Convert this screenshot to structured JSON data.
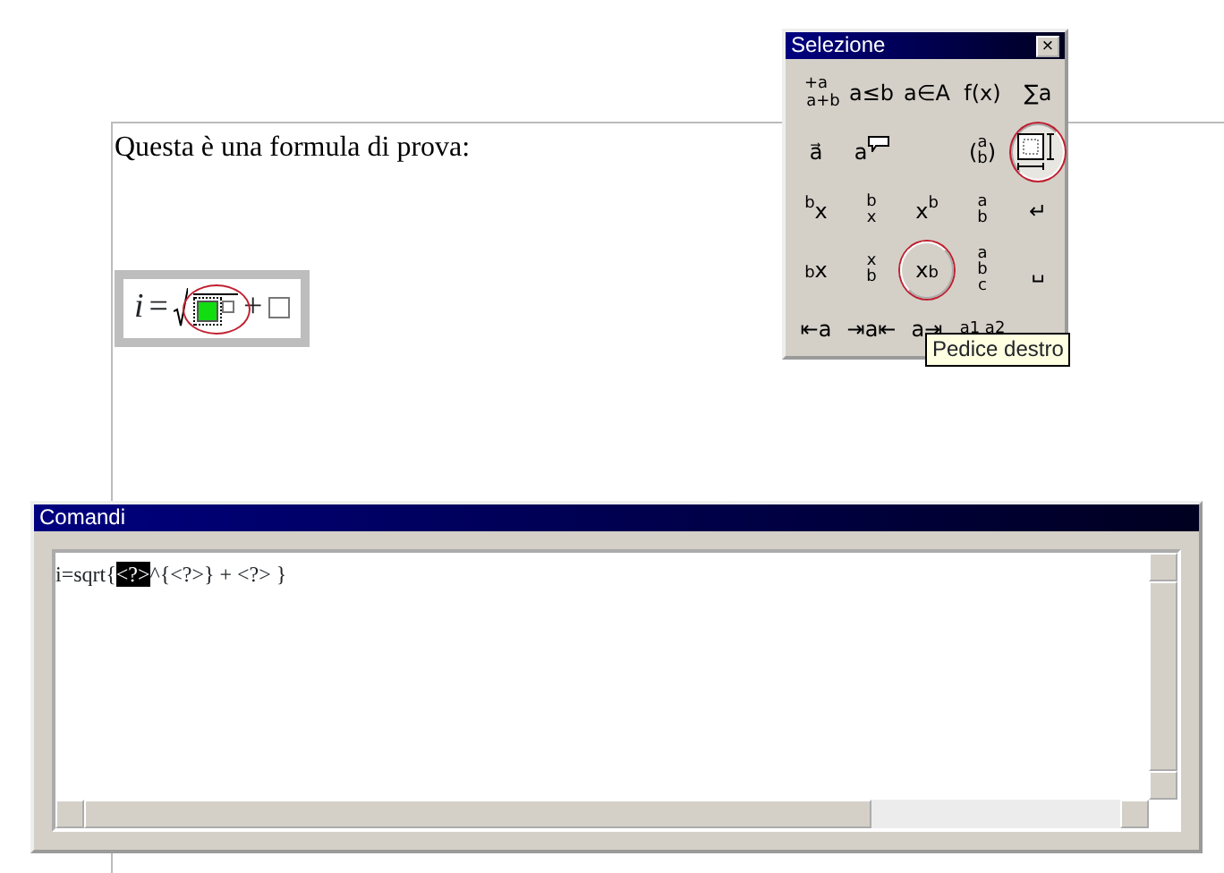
{
  "document": {
    "text": "Questa è una formula di prova:",
    "formula": {
      "lhs": "i",
      "equals": "=",
      "plus": "+",
      "highlighted": true,
      "placeholders": [
        {
          "selected": true
        },
        {
          "selected": false
        },
        {
          "selected": false
        }
      ]
    }
  },
  "palette": {
    "title": "Selezione",
    "close": "×",
    "buttons": [
      {
        "kind": "frac",
        "top": "+a",
        "bottom": "a+b",
        "pressed": false,
        "hovered": false,
        "highlighted": false
      },
      {
        "kind": "text",
        "label": "a≤b",
        "pressed": false,
        "hovered": false,
        "highlighted": false
      },
      {
        "kind": "text",
        "label": "a∈A",
        "pressed": false,
        "hovered": false,
        "highlighted": false
      },
      {
        "kind": "text",
        "label": "f(x)",
        "pressed": false,
        "hovered": false,
        "highlighted": false
      },
      {
        "kind": "text",
        "label": "∑a",
        "pressed": false,
        "hovered": false,
        "highlighted": false
      },
      {
        "kind": "text",
        "label": "a⃗",
        "pressed": false,
        "hovered": false,
        "highlighted": false
      },
      {
        "kind": "comment",
        "label": "a",
        "pressed": false,
        "hovered": false,
        "highlighted": false
      },
      {
        "kind": "blank"
      },
      {
        "kind": "stack",
        "items": [
          "a",
          "b"
        ],
        "open": "(",
        "close": ")",
        "pressed": false,
        "hovered": false,
        "highlighted": false
      },
      {
        "kind": "format",
        "pressed": true,
        "hovered": false,
        "highlighted": true
      },
      {
        "kind": "text",
        "label": "$^{b}$x",
        "pressed": false,
        "hovered": false,
        "highlighted": false
      },
      {
        "kind": "stack",
        "items": [
          "b",
          "x"
        ],
        "pressed": false,
        "hovered": false,
        "highlighted": false
      },
      {
        "kind": "text",
        "label": "x$^{b}$",
        "pressed": false,
        "hovered": false,
        "highlighted": false
      },
      {
        "kind": "stack",
        "items": [
          "a",
          "b"
        ],
        "pressed": false,
        "hovered": false,
        "highlighted": false
      },
      {
        "kind": "text",
        "label": "↵",
        "pressed": false,
        "hovered": false,
        "highlighted": false
      },
      {
        "kind": "text",
        "label": "$_{b}$x",
        "pressed": false,
        "hovered": false,
        "highlighted": false
      },
      {
        "kind": "stack",
        "items": [
          "x",
          "b"
        ],
        "pressed": false,
        "hovered": false,
        "highlighted": false
      },
      {
        "kind": "text",
        "label": "x$_{b}$",
        "pressed": false,
        "hovered": true,
        "highlighted": true
      },
      {
        "kind": "stack",
        "items": [
          "a",
          "b",
          "c"
        ],
        "pressed": false,
        "hovered": false,
        "highlighted": false
      },
      {
        "kind": "text",
        "label": "␣",
        "pressed": false,
        "hovered": false,
        "highlighted": false
      },
      {
        "kind": "text",
        "label": "⇤a",
        "pressed": false,
        "hovered": false,
        "highlighted": false
      },
      {
        "kind": "text",
        "label": "⇥a⇤",
        "pressed": false,
        "hovered": false,
        "highlighted": false
      },
      {
        "kind": "text",
        "label": "a⇥",
        "pressed": false,
        "hovered": false,
        "highlighted": false
      },
      {
        "kind": "stack",
        "items": [
          "a1 a2"
        ],
        "pressed": false,
        "hovered": false,
        "highlighted": false
      }
    ],
    "tooltip": "Pedice destro"
  },
  "commands": {
    "title": "Comandi",
    "segments": [
      {
        "text": "i=sqrt{",
        "selected": false
      },
      {
        "text": "<?>",
        "selected": true
      },
      {
        "text": "^{<?>} + <?> }",
        "selected": false
      }
    ]
  }
}
